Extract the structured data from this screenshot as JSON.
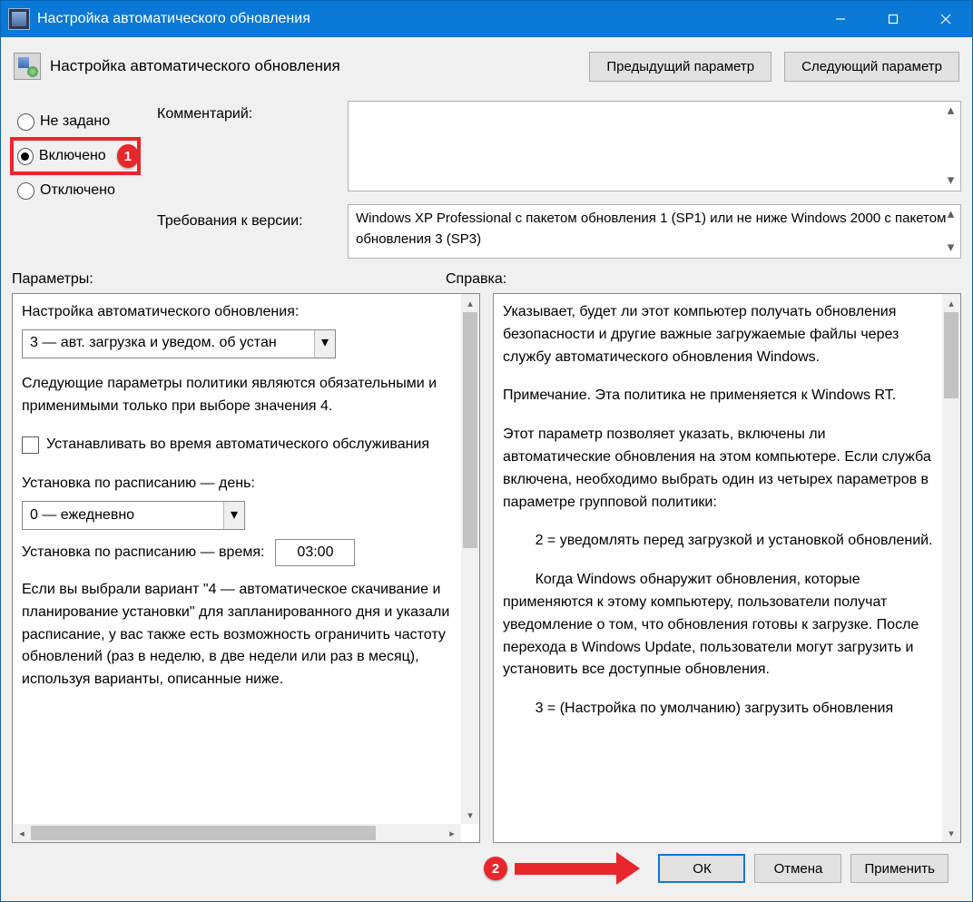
{
  "title": "Настройка автоматического обновления",
  "header": {
    "title": "Настройка автоматического обновления"
  },
  "nav": {
    "prev": "Предыдущий параметр",
    "next": "Следующий параметр"
  },
  "state": {
    "not_configured": "Не задано",
    "enabled": "Включено",
    "disabled": "Отключено"
  },
  "labels": {
    "comment": "Комментарий:",
    "supported": "Требования к версии:",
    "options": "Параметры:",
    "help": "Справка:"
  },
  "supported_text": "Windows XP Professional с пакетом обновления 1 (SP1) или не ниже Windows 2000 с пакетом обновления 3 (SP3)",
  "options": {
    "l_update": "Настройка автоматического обновления:",
    "combo_update": "3 — авт. загрузка и уведом. об устан",
    "note1": "Следующие параметры политики являются обязательными и применимыми только при выборе значения 4.",
    "chk": "Устанавливать во время автоматического обслуживания",
    "l_day": "Установка по расписанию — день:",
    "combo_day": "0 — ежедневно",
    "l_time": "Установка по расписанию — время:",
    "time": "03:00",
    "note2": "Если вы выбрали вариант \"4 — автоматическое скачивание и планирование установки\" для запланированного дня и указали расписание, у вас также есть возможность ограничить частоту обновлений (раз в неделю, в две недели или раз в месяц), используя варианты, описанные ниже."
  },
  "help": {
    "p1": "Указывает, будет ли этот компьютер получать обновления безопасности и другие важные загружаемые файлы через службу автоматического обновления Windows.",
    "p2": "Примечание. Эта политика не применяется к Windows RT.",
    "p3": "Этот параметр позволяет указать, включены ли автоматические обновления на этом компьютере. Если служба включена, необходимо выбрать один из четырех параметров в параметре групповой политики:",
    "p4": "        2 = уведомлять перед загрузкой и установкой обновлений.",
    "p5": "        Когда Windows обнаружит обновления, которые применяются к этому компьютеру, пользователи получат уведомление о том, что обновления готовы к загрузке. После перехода в Windows Update, пользователи могут загрузить и установить все доступные обновления.",
    "p6": "        3 = (Настройка по умолчанию) загрузить обновления"
  },
  "footer": {
    "ok": "ОК",
    "cancel": "Отмена",
    "apply": "Применить"
  },
  "callouts": {
    "c1": "1",
    "c2": "2"
  }
}
